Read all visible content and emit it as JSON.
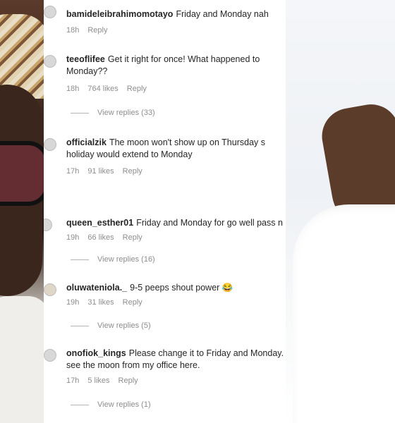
{
  "comments": [
    {
      "user": "bamideleibrahimomotayo",
      "text": "Friday and Monday nah",
      "time": "18h",
      "likes": "",
      "reply": "Reply",
      "view_replies": ""
    },
    {
      "user": "teeoflifee",
      "text": "Get it right for once! What happened to",
      "text2": "Monday??",
      "time": "18h",
      "likes": "764 likes",
      "reply": "Reply",
      "view_replies": "View replies (33)"
    },
    {
      "user": "officialzik",
      "text": "The moon won't show up on Thursday s",
      "text2": "holiday would extend to Monday",
      "time": "17h",
      "likes": "91 likes",
      "reply": "Reply",
      "view_replies": ""
    },
    {
      "user": "queen_esther01",
      "text": "Friday and Monday for go well pass n",
      "time": "19h",
      "likes": "66 likes",
      "reply": "Reply",
      "view_replies": "View replies (16)"
    },
    {
      "user": "oluwateniola._",
      "text": "9-5 peeps shout power 😂",
      "time": "19h",
      "likes": "31 likes",
      "reply": "Reply",
      "view_replies": "View replies (5)"
    },
    {
      "user": "onofiok_kings",
      "text": "Please change it to Friday and Monday.",
      "text2": "see the moon from my office here.",
      "time": "17h",
      "likes": "5 likes",
      "reply": "Reply",
      "view_replies": "View replies (1)"
    }
  ]
}
